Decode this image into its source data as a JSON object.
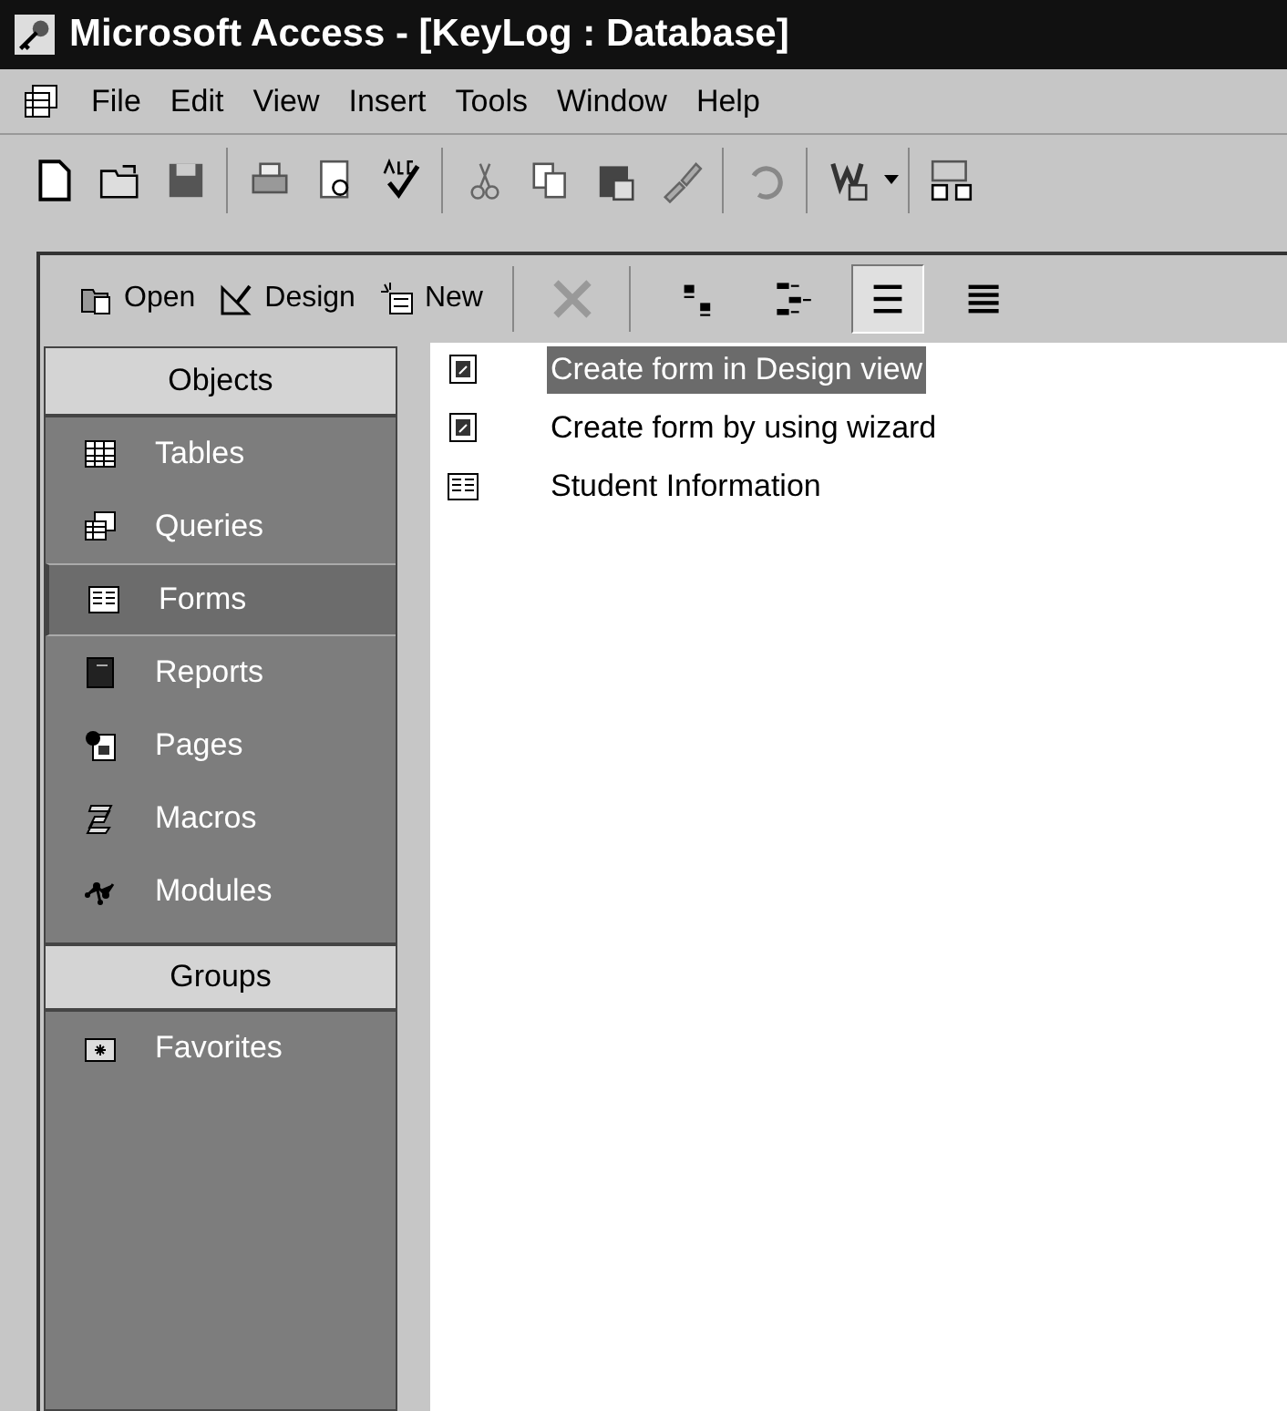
{
  "window": {
    "title": "Microsoft Access - [KeyLog : Database]"
  },
  "menu": [
    "File",
    "Edit",
    "View",
    "Insert",
    "Tools",
    "Window",
    "Help"
  ],
  "db_toolbar": [
    {
      "label": "Open",
      "kind": "open"
    },
    {
      "label": "Design",
      "kind": "design"
    },
    {
      "label": "New",
      "kind": "new"
    }
  ],
  "view_buttons": [
    {
      "kind": "large",
      "selected": false
    },
    {
      "kind": "small",
      "selected": false
    },
    {
      "kind": "list",
      "selected": true
    },
    {
      "kind": "details",
      "selected": false
    }
  ],
  "sidebar": {
    "objects_header": "Objects",
    "objects": [
      {
        "label": "Tables",
        "kind": "tables",
        "selected": false
      },
      {
        "label": "Queries",
        "kind": "queries",
        "selected": false
      },
      {
        "label": "Forms",
        "kind": "forms",
        "selected": true
      },
      {
        "label": "Reports",
        "kind": "reports",
        "selected": false
      },
      {
        "label": "Pages",
        "kind": "pages",
        "selected": false
      },
      {
        "label": "Macros",
        "kind": "macros",
        "selected": false
      },
      {
        "label": "Modules",
        "kind": "modules",
        "selected": false
      }
    ],
    "groups_header": "Groups",
    "groups": [
      {
        "label": "Favorites",
        "kind": "favorites",
        "selected": false
      }
    ]
  },
  "items": [
    {
      "label": "Create form in Design view",
      "kind": "shortcut",
      "selected": true
    },
    {
      "label": "Create form by using wizard",
      "kind": "shortcut",
      "selected": false
    },
    {
      "label": "Student Information",
      "kind": "form",
      "selected": false
    }
  ]
}
